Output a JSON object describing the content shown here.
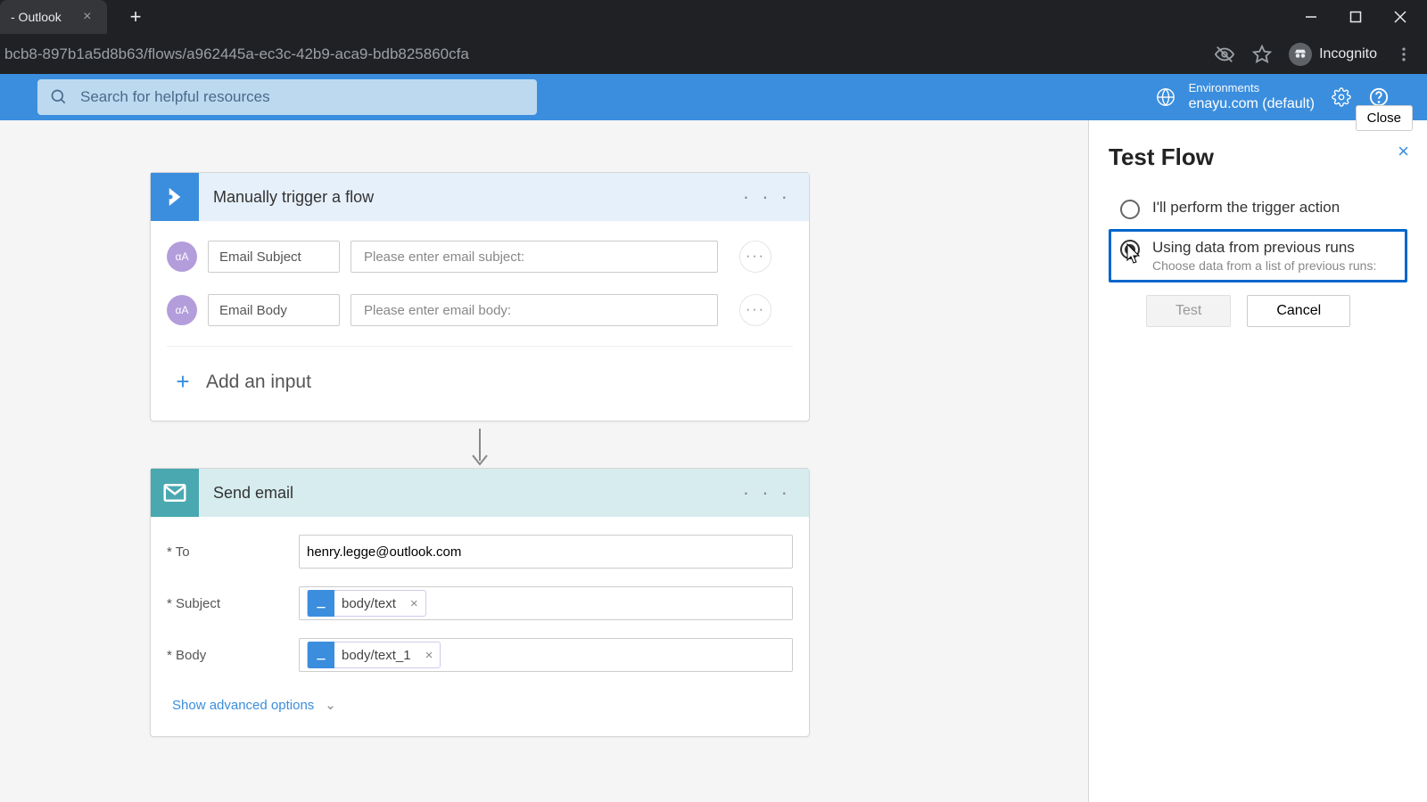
{
  "browser": {
    "tab_title": "- Outlook",
    "url_fragment": "bcb8-897b1a5d8b63/flows/a962445a-ec3c-42b9-aca9-bdb825860cfa",
    "incognito_label": "Incognito"
  },
  "header": {
    "search_placeholder": "Search for helpful resources",
    "env_label": "Environments",
    "env_value": "enayu.com (default)",
    "close_tooltip": "Close"
  },
  "trigger_card": {
    "title": "Manually trigger a flow",
    "rows": [
      {
        "label": "Email Subject",
        "placeholder": "Please enter email subject:"
      },
      {
        "label": "Email Body",
        "placeholder": "Please enter email body:"
      }
    ],
    "add_input_label": "Add an input"
  },
  "action_card": {
    "title": "Send email",
    "to_label": "* To",
    "to_value": "henry.legge@outlook.com",
    "subject_label": "* Subject",
    "subject_token": "body/text",
    "body_label": "* Body",
    "body_token": "body/text_1",
    "show_advanced": "Show advanced options"
  },
  "panel": {
    "title": "Test Flow",
    "option1": "I'll perform the trigger action",
    "option2": "Using data from previous runs",
    "option2_sub": "Choose data from a list of previous runs:",
    "test_btn": "Test",
    "cancel_btn": "Cancel"
  }
}
